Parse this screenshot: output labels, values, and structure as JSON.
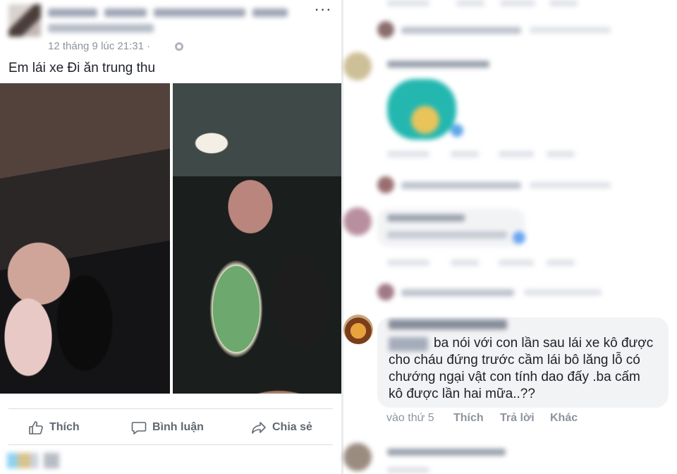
{
  "post": {
    "author_name": "",
    "time": "12 tháng 9 lúc 21:31 ·",
    "more_icon": "more-horizontal-icon",
    "text": "Em lái xe Đi ăn trung thu",
    "actions": {
      "like": "Thích",
      "comment": "Bình luận",
      "share": "Chia sẻ"
    }
  },
  "comment": {
    "text": "ba nói với con lần sau lái xe kô được cho cháu đứng trước cầm lái bô lăng lỗ có chướng ngại vật con tính dao đấy .ba cấm kô được lần hai mữa..??",
    "meta": {
      "time": "vào thứ 5",
      "like": "Thích",
      "reply": "Trả lời",
      "more": "Khác"
    }
  },
  "colors": {
    "secondary_text": "#8d949e",
    "action_text": "#606770",
    "bubble": "#f2f3f5"
  }
}
